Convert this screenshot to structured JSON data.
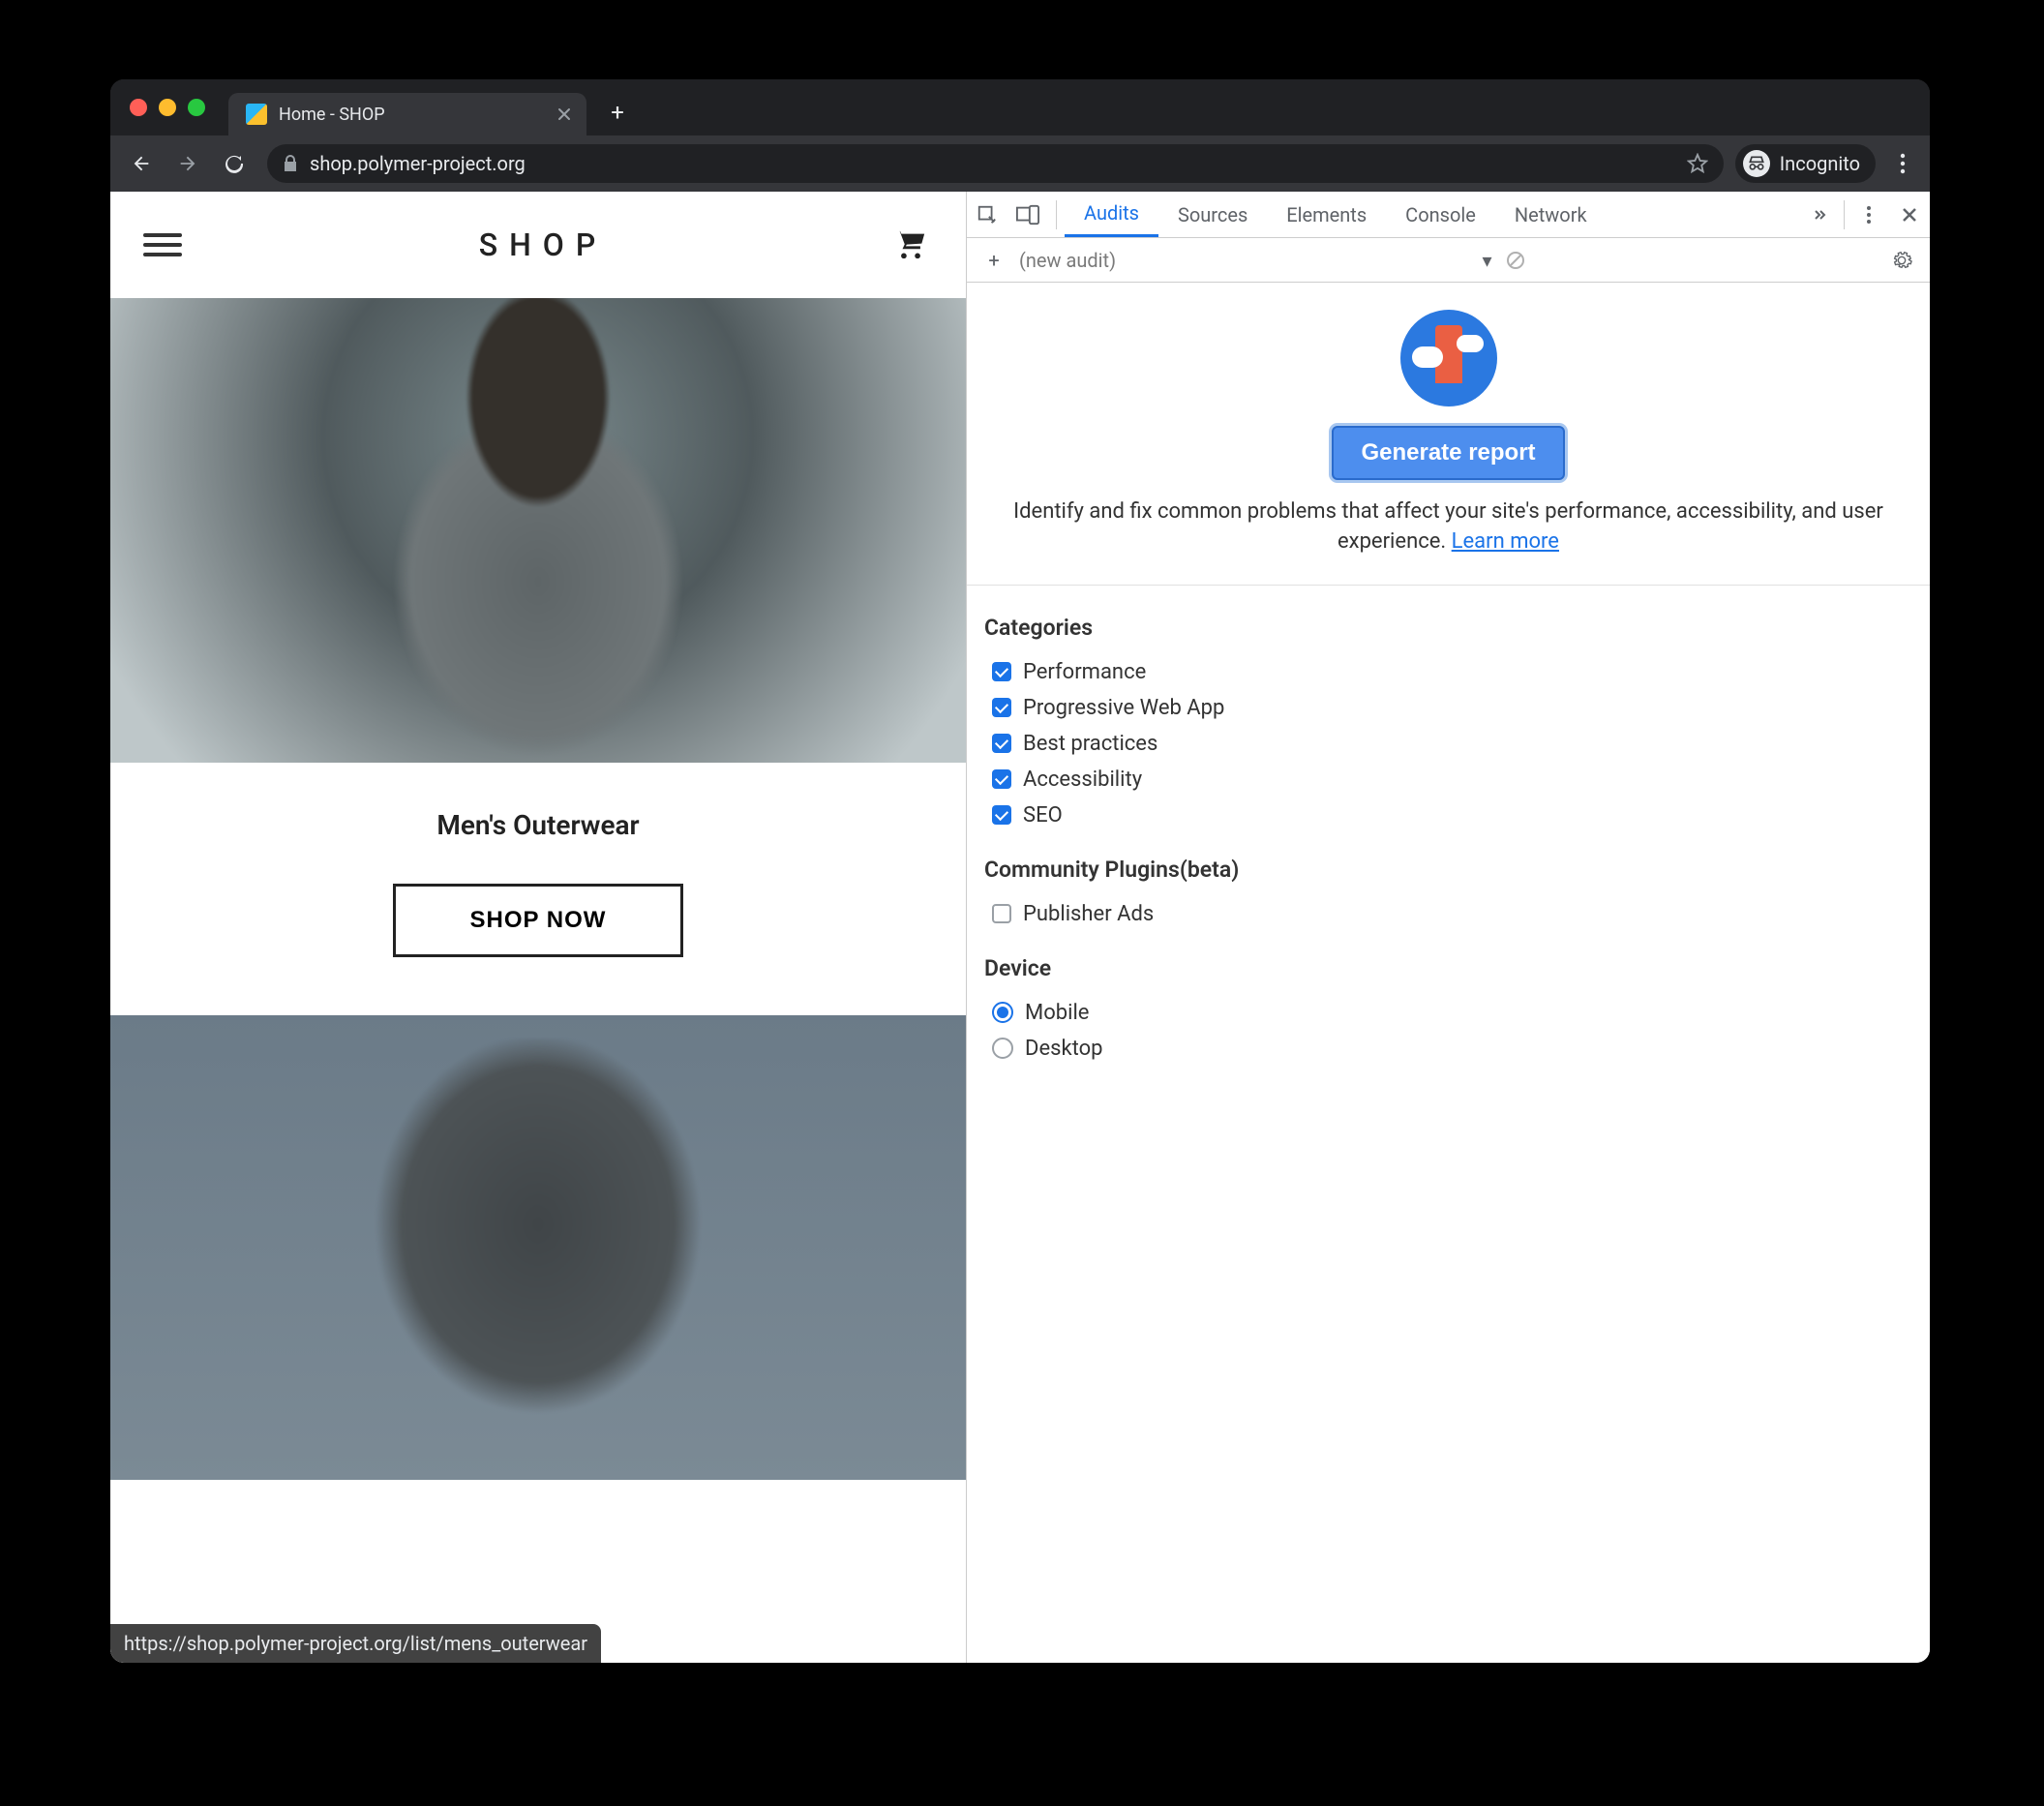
{
  "browser": {
    "tab_title": "Home - SHOP",
    "url": "shop.polymer-project.org",
    "incognito_label": "Incognito",
    "status_url": "https://shop.polymer-project.org/list/mens_outerwear"
  },
  "shop": {
    "logo": "SHOP",
    "section_title": "Men's Outerwear",
    "cta_label": "SHOP NOW"
  },
  "devtools": {
    "tabs": [
      "Audits",
      "Sources",
      "Elements",
      "Console",
      "Network"
    ],
    "active_tab": "Audits",
    "subbar_label": "(new audit)",
    "generate_button": "Generate report",
    "description": "Identify and fix common problems that affect your site's performance, accessibility, and user experience. ",
    "learn_more": "Learn more",
    "sections": {
      "categories_title": "Categories",
      "categories": [
        {
          "label": "Performance",
          "checked": true
        },
        {
          "label": "Progressive Web App",
          "checked": true
        },
        {
          "label": "Best practices",
          "checked": true
        },
        {
          "label": "Accessibility",
          "checked": true
        },
        {
          "label": "SEO",
          "checked": true
        }
      ],
      "plugins_title": "Community Plugins(beta)",
      "plugins": [
        {
          "label": "Publisher Ads",
          "checked": false
        }
      ],
      "device_title": "Device",
      "devices": [
        {
          "label": "Mobile",
          "selected": true
        },
        {
          "label": "Desktop",
          "selected": false
        }
      ]
    }
  }
}
